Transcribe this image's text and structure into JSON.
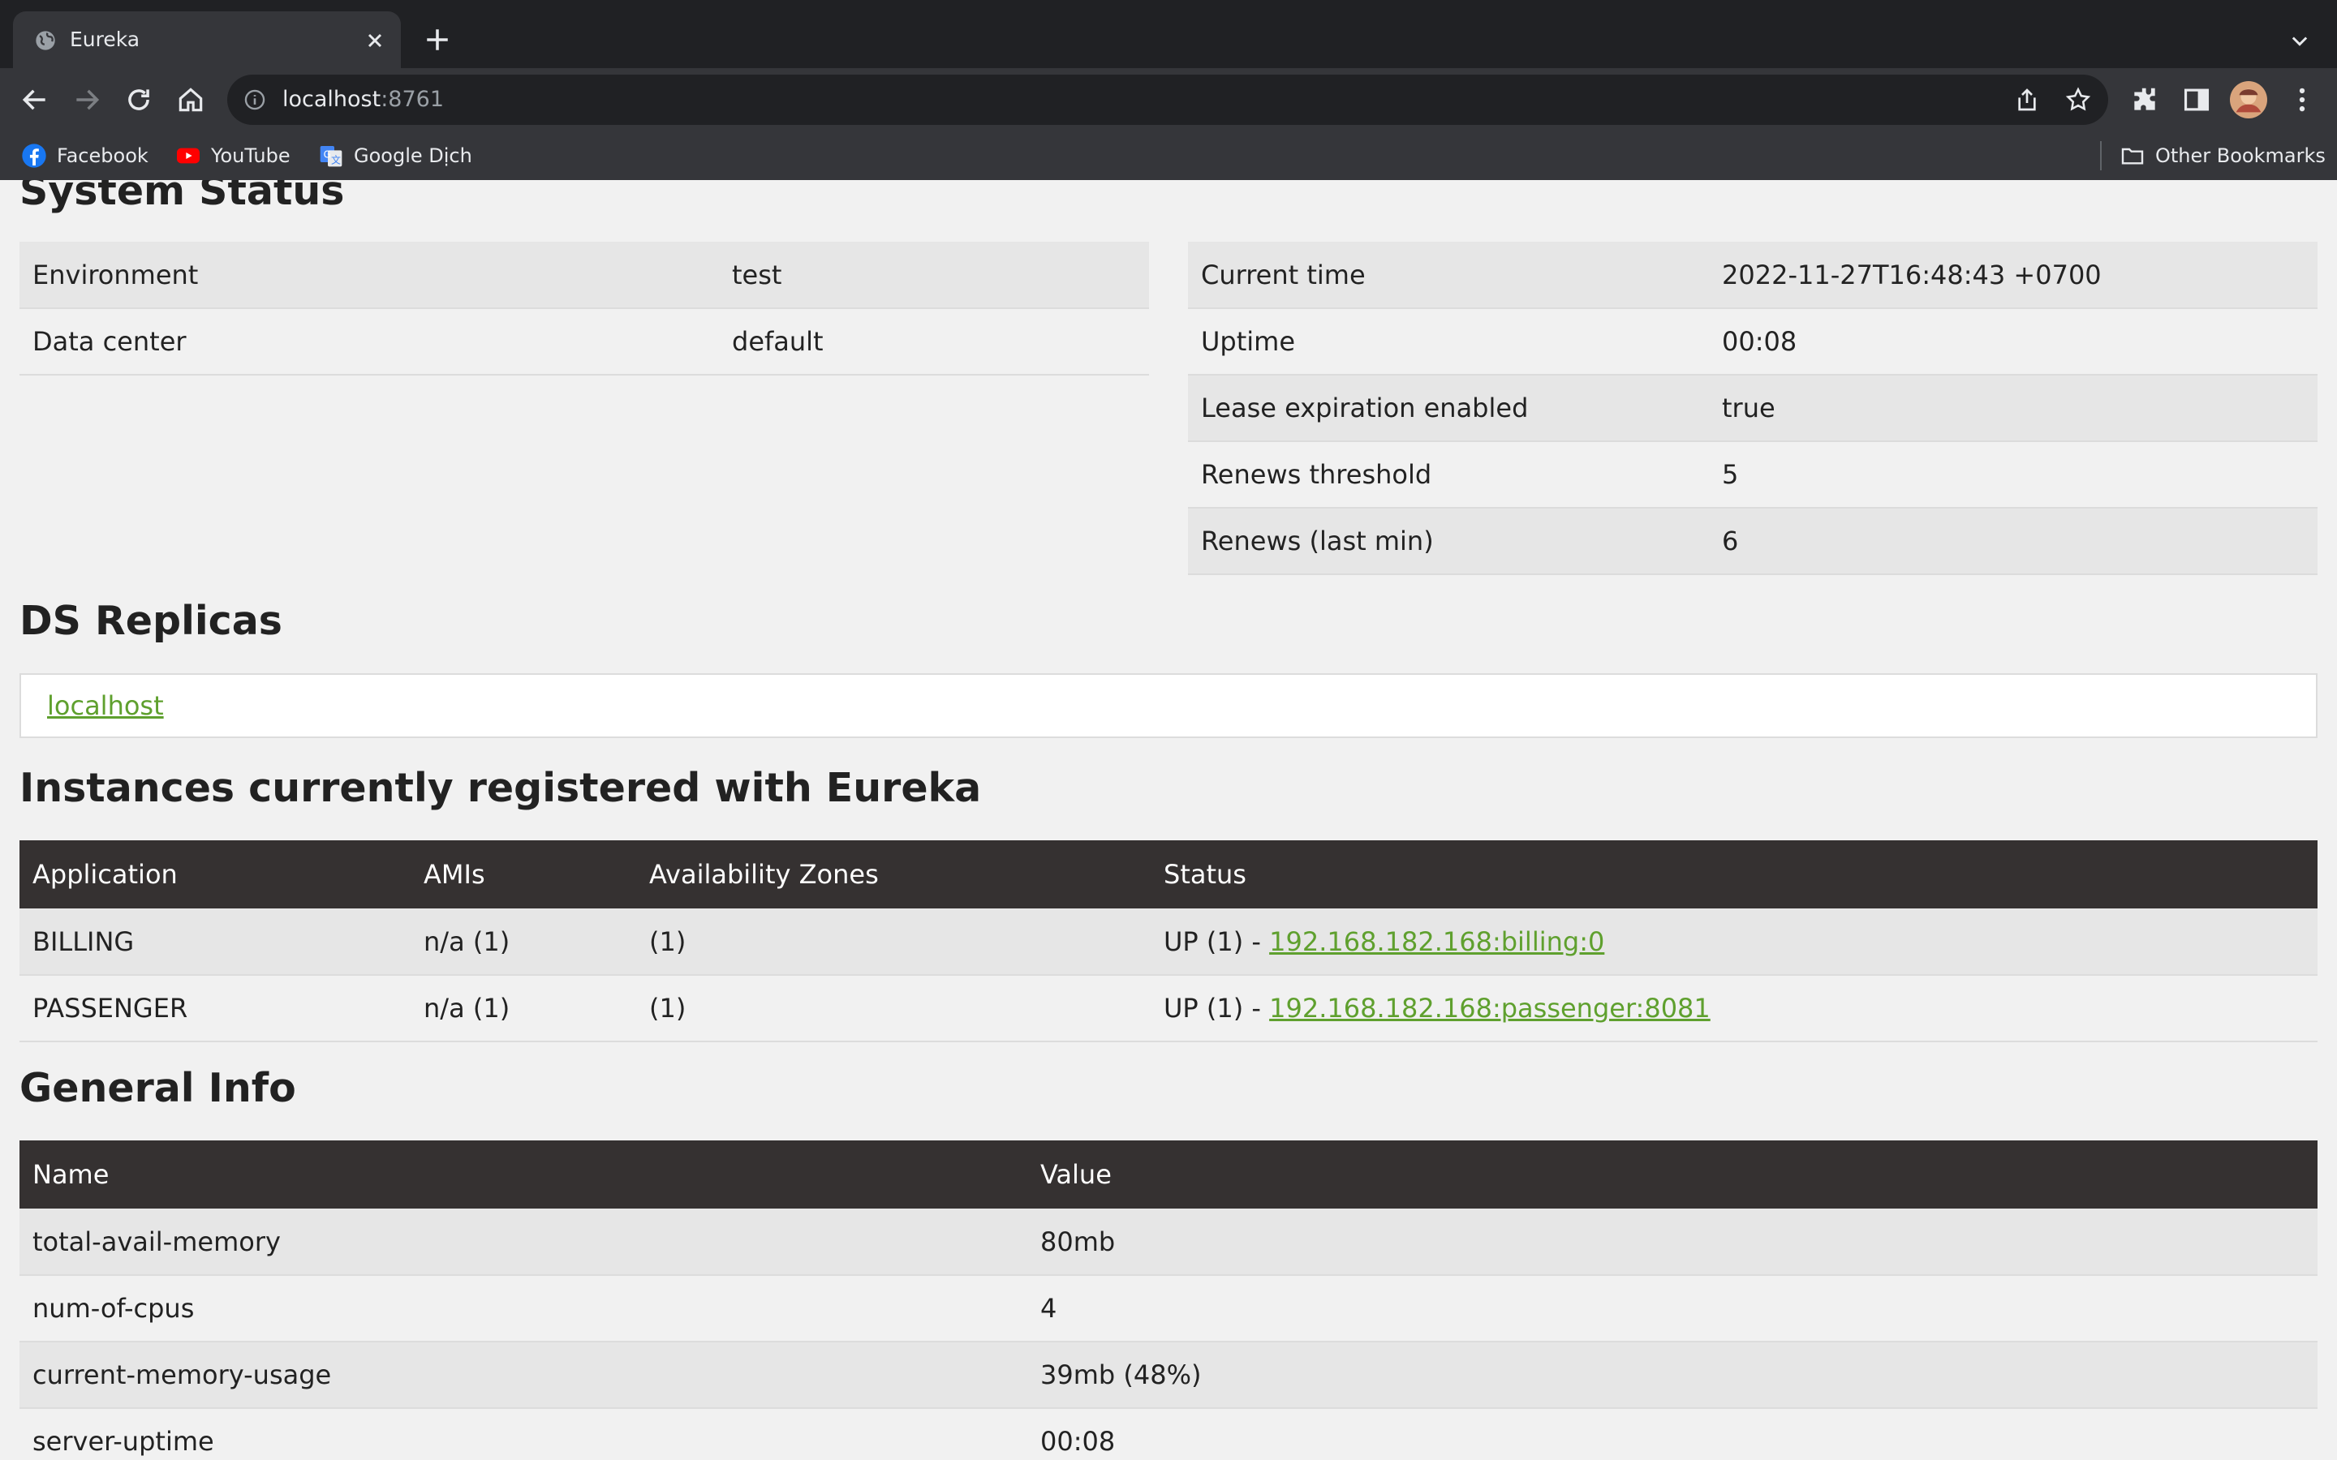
{
  "browser": {
    "tab_title": "Eureka",
    "url_host": "localhost",
    "url_port": ":8761",
    "bookmarks": [
      {
        "label": "Facebook",
        "icon": "facebook-icon"
      },
      {
        "label": "YouTube",
        "icon": "youtube-icon"
      },
      {
        "label": "Google Dịch",
        "icon": "google-translate-icon"
      }
    ],
    "other_bookmarks": "Other Bookmarks"
  },
  "system_status": {
    "heading": "System Status",
    "left": [
      {
        "label": "Environment",
        "value": "test"
      },
      {
        "label": "Data center",
        "value": "default"
      }
    ],
    "right": [
      {
        "label": "Current time",
        "value": "2022-11-27T16:48:43 +0700"
      },
      {
        "label": "Uptime",
        "value": "00:08"
      },
      {
        "label": "Lease expiration enabled",
        "value": "true"
      },
      {
        "label": "Renews threshold",
        "value": "5"
      },
      {
        "label": "Renews (last min)",
        "value": "6"
      }
    ]
  },
  "ds_replicas": {
    "heading": "DS Replicas",
    "link": "localhost"
  },
  "instances": {
    "heading": "Instances currently registered with Eureka",
    "columns": [
      "Application",
      "AMIs",
      "Availability Zones",
      "Status"
    ],
    "rows": [
      {
        "application": "BILLING",
        "amis": "n/a (1)",
        "zones": "(1)",
        "status_prefix": "UP (1) - ",
        "status_link": "192.168.182.168:billing:0"
      },
      {
        "application": "PASSENGER",
        "amis": "n/a (1)",
        "zones": "(1)",
        "status_prefix": "UP (1) - ",
        "status_link": "192.168.182.168:passenger:8081"
      }
    ]
  },
  "general_info": {
    "heading": "General Info",
    "columns": [
      "Name",
      "Value"
    ],
    "rows": [
      {
        "name": "total-avail-memory",
        "value": "80mb"
      },
      {
        "name": "num-of-cpus",
        "value": "4"
      },
      {
        "name": "current-memory-usage",
        "value": "39mb (48%)"
      },
      {
        "name": "server-uptime",
        "value": "00:08"
      }
    ]
  },
  "colors": {
    "link": "#5fa02e",
    "table_header": "#353131",
    "row_shade": "#e6e6e6",
    "page_bg": "#f1f1f1"
  }
}
